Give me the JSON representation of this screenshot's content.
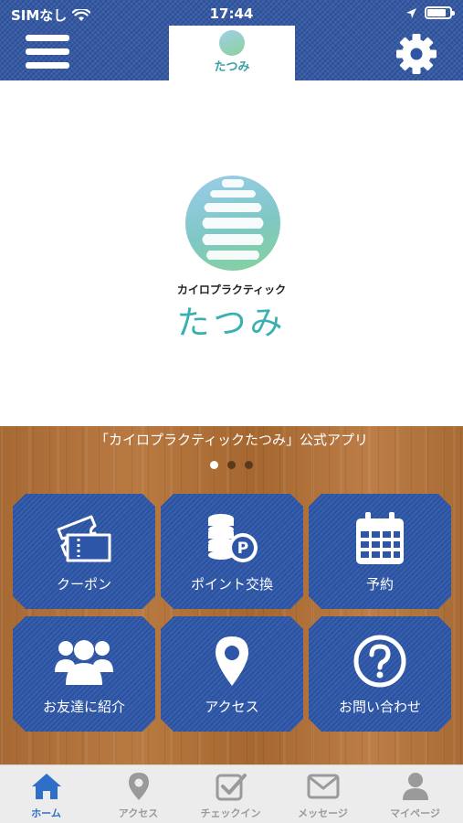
{
  "status_bar": {
    "carrier": "SIMなし",
    "time": "17:44"
  },
  "header": {
    "logo_text": "たつみ"
  },
  "hero": {
    "subtitle": "カイロプラクティック",
    "brand": "たつみ"
  },
  "banner": {
    "caption": "「カイロプラクティックたつみ」公式アプリ",
    "slide_count": 3,
    "active_slide": 1
  },
  "menu_tiles": [
    {
      "label": "クーポン",
      "icon": "ticket-icon"
    },
    {
      "label": "ポイント交換",
      "icon": "coins-point-icon"
    },
    {
      "label": "予約",
      "icon": "calendar-icon"
    },
    {
      "label": "お友達に紹介",
      "icon": "users-icon"
    },
    {
      "label": "アクセス",
      "icon": "map-pin-icon"
    },
    {
      "label": "お問い合わせ",
      "icon": "question-icon"
    }
  ],
  "tabbar": {
    "items": [
      {
        "label": "ホーム",
        "icon": "home-icon",
        "active": true
      },
      {
        "label": "アクセス",
        "icon": "map-pin-icon",
        "active": false
      },
      {
        "label": "チェックイン",
        "icon": "checkbox-icon",
        "active": false
      },
      {
        "label": "メッセージ",
        "icon": "envelope-icon",
        "active": false
      },
      {
        "label": "マイページ",
        "icon": "user-icon",
        "active": false
      }
    ]
  },
  "colors": {
    "header_blue": "#2f55a3",
    "tile_blue": "#2d56a8",
    "brand_teal": "#3ab0b0",
    "tab_active": "#2f6fc8",
    "tab_inactive": "#9a9a9a"
  }
}
